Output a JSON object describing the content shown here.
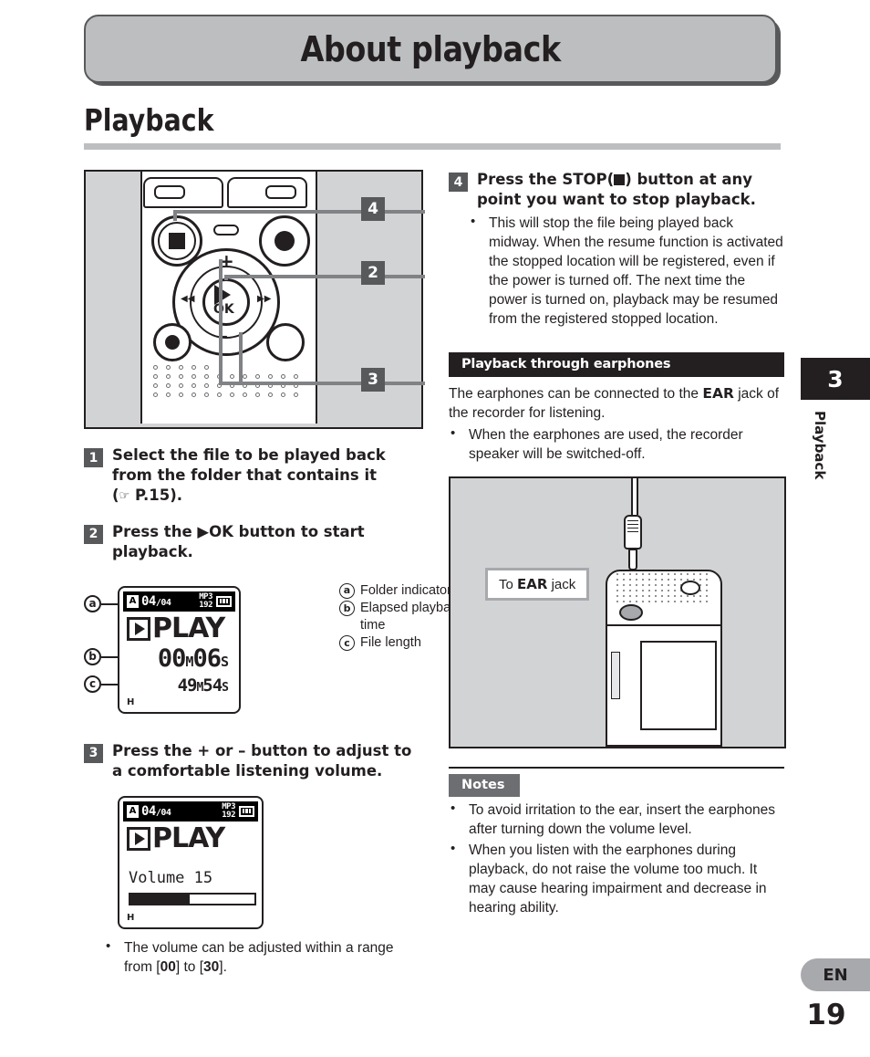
{
  "header": {
    "banner_title": "About playback"
  },
  "section": {
    "title": "Playback"
  },
  "device_figure": {
    "callouts": [
      {
        "id": "callout-4",
        "label": "4"
      },
      {
        "id": "callout-2",
        "label": "2"
      },
      {
        "id": "callout-3",
        "label": "3"
      }
    ],
    "button_labels": {
      "ok": "OK",
      "plus": "+",
      "minus": "–",
      "rewind": "◀◀",
      "forward": "▶▶"
    }
  },
  "steps": {
    "step1": {
      "num": "1",
      "text_line1": "Select the file to be played back",
      "text_line2": "from the folder that contains it",
      "text_line3_pre": "(",
      "text_line3_ref": "P.15",
      "text_line3_post": ")."
    },
    "step2": {
      "num": "2",
      "text_pre": "Press the",
      "text_btn": "▶OK",
      "text_post": "button to start playback."
    },
    "step3": {
      "num": "3",
      "text": "Press the + or – button to adjust to a comfortable listening volume."
    },
    "step4": {
      "num": "4",
      "text_pre": "Press the",
      "text_bold": "STOP",
      "text_paren_open": "(",
      "text_paren_close": ")",
      "text_post": "button at any point you want to stop playback.",
      "bullet": "This will stop the file being played back midway. When the resume function is activated the stopped location will be registered, even if the power is turned off. The next time the power is turned on, playback may be resumed from the registered stopped location."
    }
  },
  "lcd_play": {
    "folder_letter": "A",
    "file_current": "04",
    "file_separator": "/",
    "file_total": "04",
    "codec_line1": "MP3",
    "codec_line2": "192",
    "status_word": "PLAY",
    "elapsed_minutes": "00",
    "elapsed_m_unit": "M",
    "elapsed_seconds": "06",
    "elapsed_s_unit": "S",
    "length_minutes": "49",
    "length_m_unit": "M",
    "length_seconds": "54",
    "length_s_unit": "S",
    "footer_icon": "H"
  },
  "lcd_legend": [
    {
      "badge": "a",
      "text": "Folder indicator"
    },
    {
      "badge": "b",
      "text": "Elapsed playback time"
    },
    {
      "badge": "c",
      "text": "File length"
    }
  ],
  "lcd_markers": {
    "a": "a",
    "b": "b",
    "c": "c"
  },
  "lcd_volume": {
    "folder_letter": "A",
    "file_current": "04",
    "file_separator": "/",
    "file_total": "04",
    "codec_line1": "MP3",
    "codec_line2": "192",
    "status_word": "PLAY",
    "volume_label": "Volume 15",
    "footer_icon": "H"
  },
  "volume_note": {
    "text_pre": "The volume can be adjusted within a range from [",
    "min": "00",
    "text_mid": "] to [",
    "max": "30",
    "text_post": "]."
  },
  "earphones_section": {
    "header": "Playback through earphones",
    "paragraph_pre": "The earphones can be connected to the",
    "paragraph_bold": "EAR",
    "paragraph_post": "jack of the recorder for listening.",
    "bullet": "When the earphones are used, the recorder speaker will be switched-off."
  },
  "earphone_figure": {
    "label_pre": "To",
    "label_bold": "EAR",
    "label_post": "jack"
  },
  "notes": {
    "title": "Notes",
    "items": [
      "To avoid irritation to the ear, insert the earphones after turning down the volume level.",
      "When you listen with the earphones during playback, do not raise the volume too much. It may cause hearing impairment and decrease in hearing ability."
    ]
  },
  "edge": {
    "chapter_number": "3",
    "chapter_label": "Playback",
    "language": "EN",
    "page_number": "19"
  },
  "colors": {
    "banner_fill": "#bcbec0",
    "banner_border": "#58595b",
    "callout_box": "#58595b",
    "figure_bg": "#d1d3d4",
    "rule": "#bcbec0",
    "notes_badge": "#6d6e71",
    "black": "#231f20"
  }
}
